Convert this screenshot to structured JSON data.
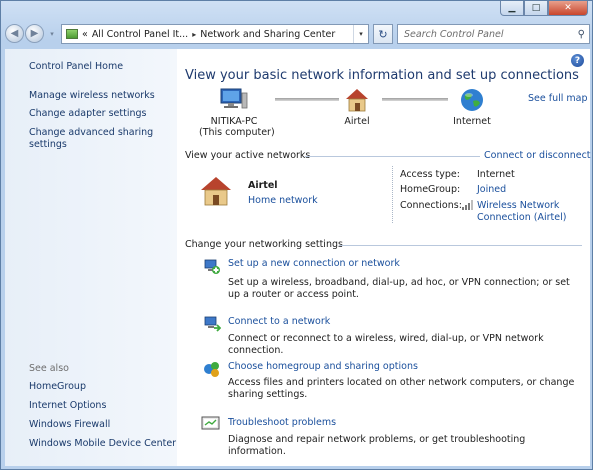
{
  "window": {
    "controls": {
      "minimize": "▁",
      "maximize": "□",
      "close": "✕"
    }
  },
  "nav": {
    "back_icon": "back-arrow",
    "forward_icon": "forward-arrow",
    "address": {
      "chevron": "«",
      "crumbs": [
        "All Control Panel It...",
        "Network and Sharing Center"
      ],
      "separator": "▸"
    },
    "search_placeholder": "Search Control Panel"
  },
  "sidebar": {
    "home": "Control Panel Home",
    "links": [
      "Manage wireless networks",
      "Change adapter settings",
      "Change advanced sharing settings"
    ],
    "see_also_label": "See also",
    "see_also": [
      "HomeGroup",
      "Internet Options",
      "Windows Firewall",
      "Windows Mobile Device Center"
    ]
  },
  "main": {
    "headline": "View your basic network information and set up connections",
    "see_full_map": "See full map",
    "map": {
      "computer_name": "NITIKA-PC",
      "computer_sub": "(This computer)",
      "network": "Airtel",
      "internet": "Internet"
    },
    "active_header": "View your active networks",
    "connect_link": "Connect or disconnect",
    "active": {
      "name": "Airtel",
      "type": "Home network",
      "access_type_label": "Access type:",
      "access_type_value": "Internet",
      "homegroup_label": "HomeGroup:",
      "homegroup_value": "Joined",
      "connections_label": "Connections:",
      "connections_value_1": "Wireless Network",
      "connections_value_2": "Connection (Airtel)"
    },
    "settings_header": "Change your networking settings",
    "tasks": [
      {
        "title": "Set up a new connection or network",
        "desc": "Set up a wireless, broadband, dial-up, ad hoc, or VPN connection; or set up a router or access point."
      },
      {
        "title": "Connect to a network",
        "desc": "Connect or reconnect to a wireless, wired, dial-up, or VPN network connection."
      },
      {
        "title": "Choose homegroup and sharing options",
        "desc": "Access files and printers located on other network computers, or change sharing settings."
      },
      {
        "title": "Troubleshoot problems",
        "desc": "Diagnose and repair network problems, or get troubleshooting information."
      }
    ]
  }
}
